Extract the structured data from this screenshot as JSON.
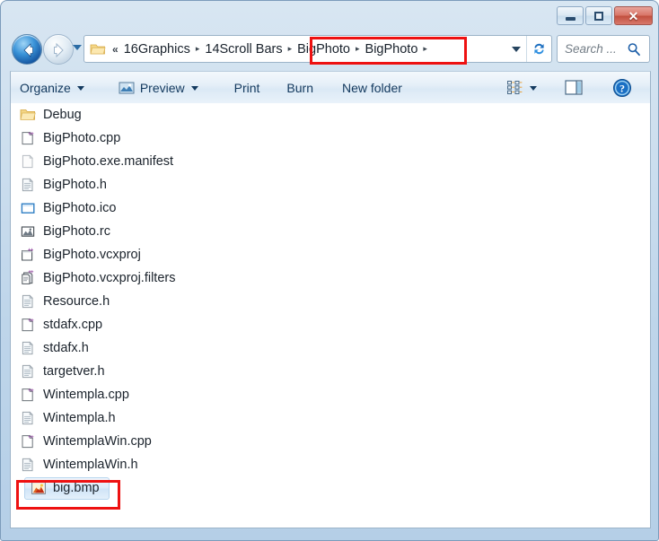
{
  "window": {
    "title": "",
    "buttons": {
      "minimize": "Minimize",
      "maximize": "Maximize",
      "close": "✕"
    }
  },
  "navigation": {
    "back_label": "Back",
    "forward_label": "Forward",
    "recent_pages_label": "Recent pages",
    "refresh_label": "Refresh",
    "breadcrumb": {
      "overflow": "«",
      "separator": "▸",
      "items": [
        {
          "label": "16Graphics"
        },
        {
          "label": "14Scroll Bars"
        },
        {
          "label": "BigPhoto"
        },
        {
          "label": "BigPhoto"
        }
      ]
    },
    "dropdown_label": "Previous locations"
  },
  "search": {
    "placeholder": "Search ...",
    "value": "Search ...",
    "icon": "search-icon"
  },
  "toolbar": {
    "organize": "Organize",
    "preview": "Preview",
    "print": "Print",
    "burn": "Burn",
    "new_folder": "New folder",
    "change_view_label": "Change your view",
    "preview_pane_label": "Show the preview pane",
    "help_label": "Get help",
    "help_glyph": "?"
  },
  "files": {
    "items": [
      {
        "name": "Debug",
        "icon": "folder-icon",
        "type": "folder",
        "selected": false
      },
      {
        "name": "BigPhoto.cpp",
        "icon": "cpp-file-icon",
        "type": "cpp",
        "selected": false
      },
      {
        "name": "BigPhoto.exe.manifest",
        "icon": "blank-file-icon",
        "type": "manifest",
        "selected": false
      },
      {
        "name": "BigPhoto.h",
        "icon": "header-file-icon",
        "type": "h",
        "selected": false
      },
      {
        "name": "BigPhoto.ico",
        "icon": "ico-file-icon",
        "type": "ico",
        "selected": false
      },
      {
        "name": "BigPhoto.rc",
        "icon": "rc-file-icon",
        "type": "rc",
        "selected": false
      },
      {
        "name": "BigPhoto.vcxproj",
        "icon": "vcxproj-file-icon",
        "type": "vcxproj",
        "selected": false
      },
      {
        "name": "BigPhoto.vcxproj.filters",
        "icon": "vcxproj-filters-file-icon",
        "type": "filters",
        "selected": false
      },
      {
        "name": "Resource.h",
        "icon": "header-file-icon",
        "type": "h",
        "selected": false
      },
      {
        "name": "stdafx.cpp",
        "icon": "cpp-file-icon",
        "type": "cpp",
        "selected": false
      },
      {
        "name": "stdafx.h",
        "icon": "header-file-icon",
        "type": "h",
        "selected": false
      },
      {
        "name": "targetver.h",
        "icon": "header-file-icon",
        "type": "h",
        "selected": false
      },
      {
        "name": "Wintempla.cpp",
        "icon": "cpp-file-icon",
        "type": "cpp",
        "selected": false
      },
      {
        "name": "Wintempla.h",
        "icon": "header-file-icon",
        "type": "h",
        "selected": false
      },
      {
        "name": "WintemplaWin.cpp",
        "icon": "cpp-file-icon",
        "type": "cpp",
        "selected": false
      },
      {
        "name": "WintemplaWin.h",
        "icon": "header-file-icon",
        "type": "h",
        "selected": false
      },
      {
        "name": "big.bmp",
        "icon": "bitmap-file-icon",
        "type": "bmp",
        "selected": true
      }
    ]
  },
  "annotations": [
    {
      "name": "breadcrumb-highlight",
      "color": "#ee1111",
      "target": "BigPhoto ▸ BigPhoto"
    },
    {
      "name": "bigbmp-highlight",
      "color": "#ee1111",
      "target": "big.bmp"
    }
  ],
  "colors": {
    "annotation": "#ee1111",
    "frame": "#b5cfe7",
    "toolbar_text": "#13395e",
    "list_text": "#1b232c",
    "selection": "#cfe4f7"
  }
}
